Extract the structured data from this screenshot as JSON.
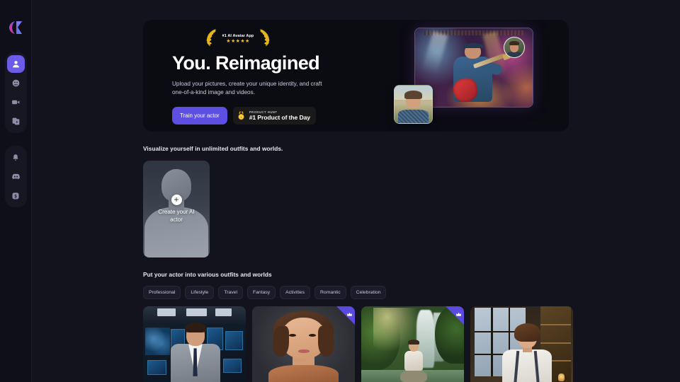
{
  "app": {
    "logo_name": "brand-logo",
    "background_color": "#13131d",
    "accent_color": "#5e4fe3"
  },
  "sidebar": {
    "primary_items": [
      {
        "id": "actors",
        "icon": "person-icon",
        "label": "Actors",
        "active": true
      },
      {
        "id": "avatars",
        "icon": "face-avatar-icon",
        "label": "Avatars",
        "active": false
      },
      {
        "id": "videos",
        "icon": "video-camera-icon",
        "label": "Videos",
        "active": false
      },
      {
        "id": "library",
        "icon": "copy-stack-icon",
        "label": "Library",
        "active": false
      }
    ],
    "secondary_items": [
      {
        "id": "notifications",
        "icon": "bell-icon",
        "label": "Notifications",
        "active": false
      },
      {
        "id": "discord",
        "icon": "discord-icon",
        "label": "Discord",
        "active": false
      },
      {
        "id": "credits",
        "icon": "coin-icon",
        "label": "Credits",
        "active": false
      }
    ]
  },
  "hero": {
    "award_badge": {
      "text": "#1 AI Avatar App",
      "stars": "★★★★★",
      "left_icon": "laurel-left-icon",
      "right_icon": "laurel-right-icon"
    },
    "title": "You. Reimagined",
    "subtitle": "Upload your pictures, create your unique identity, and craft one-of-a-kind image and videos.",
    "cta_label": "Train your actor",
    "product_hunt": {
      "kicker": "PRODUCT HUNT",
      "title": "#1 Product of the Day",
      "icon": "gold-medal-icon"
    },
    "artwork": {
      "stage_photo_alt": "Musician playing electric guitar on a concert stage",
      "avatar_alt": "Source face photo",
      "source_photo_alt": "Source portrait photo"
    }
  },
  "actor_section": {
    "heading": "Visualize yourself in unlimited outfits and worlds.",
    "create_card": {
      "label": "Create your AI actor",
      "icon": "plus-icon"
    }
  },
  "outfits_section": {
    "heading": "Put your actor into various outfits and worlds",
    "filters": [
      {
        "label": "Professional",
        "selected": false
      },
      {
        "label": "Lifestyle",
        "selected": false
      },
      {
        "label": "Travel",
        "selected": false
      },
      {
        "label": "Fantasy",
        "selected": false
      },
      {
        "label": "Activities",
        "selected": false
      },
      {
        "label": "Romantic",
        "selected": false
      },
      {
        "label": "Celebration",
        "selected": false
      }
    ],
    "gallery": [
      {
        "alt": "Man in grey suit in a broadcast newsroom",
        "premium": false,
        "badge_icon": ""
      },
      {
        "alt": "Studio portrait of a woman with short bob hair",
        "premium": true,
        "badge_icon": "crown-icon"
      },
      {
        "alt": "Woman meditating beside a jungle waterfall",
        "premium": true,
        "badge_icon": "crown-icon"
      },
      {
        "alt": "Woman in white shirt and suspenders in a loft office",
        "premium": false,
        "badge_icon": ""
      }
    ]
  }
}
